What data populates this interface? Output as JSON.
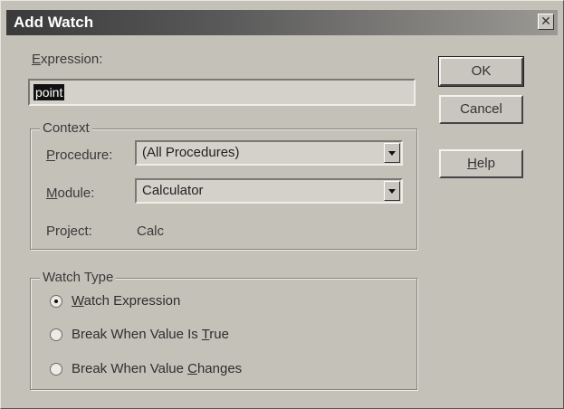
{
  "window": {
    "title": "Add Watch",
    "close_glyph": "✕"
  },
  "expression": {
    "label_prefix": "",
    "label_mnemonic": "E",
    "label_rest": "xpression:",
    "value": "point"
  },
  "buttons": {
    "ok_label": "OK",
    "cancel_label": "Cancel",
    "help_mnemonic": "H",
    "help_rest": "elp"
  },
  "context": {
    "title": "Context",
    "procedure_mnemonic": "P",
    "procedure_rest": "rocedure:",
    "procedure_value": "(All Procedures)",
    "module_prefix": "",
    "module_mnemonic": "M",
    "module_rest": "odule:",
    "module_value": "Calculator",
    "project_label": "Project:",
    "project_value": "Calc"
  },
  "watch_type": {
    "title": "Watch Type",
    "options": [
      {
        "pre": "",
        "mnemonic": "W",
        "post": "atch Expression",
        "selected": true
      },
      {
        "pre": "Break When Value Is ",
        "mnemonic": "T",
        "post": "rue",
        "selected": false
      },
      {
        "pre": "Break When Value ",
        "mnemonic": "C",
        "post": "hanges",
        "selected": false
      }
    ]
  },
  "icons": {
    "close": "close-icon",
    "dropdown": "chevron-down-icon",
    "radio": "radio-icon"
  }
}
